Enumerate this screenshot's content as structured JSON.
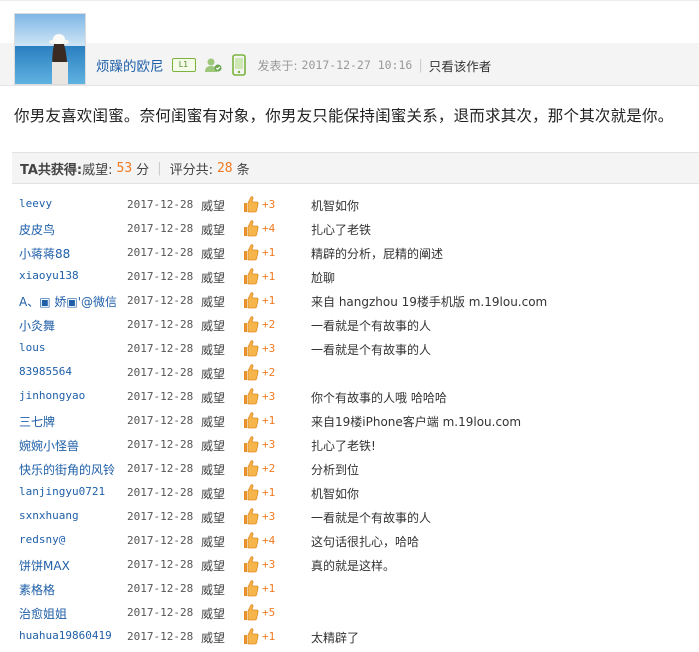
{
  "post": {
    "author": "烦躁的欧尼",
    "level_badge": "L1",
    "posted_label": "发表于:",
    "posted_time": "2017-12-27 10:16",
    "only_author": "只看该作者",
    "content": "你男友喜欢闺蜜。奈何闺蜜有对象，你男友只能保持闺蜜关系，退而求其次，那个其次就是你。"
  },
  "rating_summary": {
    "prefix": "TA共获得:",
    "type_label": "威望:",
    "points": "53",
    "points_unit": "分",
    "count_label": "评分共:",
    "count": "28",
    "count_unit": "条"
  },
  "ratings": [
    {
      "user": "leevy",
      "date": "2017-12-28",
      "type": "威望",
      "score": "+3",
      "reason": "机智如你"
    },
    {
      "user": "皮皮鸟",
      "date": "2017-12-28",
      "type": "威望",
      "score": "+4",
      "reason": "扎心了老铁"
    },
    {
      "user": "小蒋蒋88",
      "date": "2017-12-28",
      "type": "威望",
      "score": "+1",
      "reason": "精辟的分析，屁精的阐述"
    },
    {
      "user": "xiaoyu138",
      "date": "2017-12-28",
      "type": "威望",
      "score": "+1",
      "reason": "尬聊"
    },
    {
      "user": "A、▣ 娇▣'@微信",
      "date": "2017-12-28",
      "type": "威望",
      "score": "+1",
      "reason": "来自 hangzhou 19楼手机版 m.19lou.com"
    },
    {
      "user": "小灸舞",
      "date": "2017-12-28",
      "type": "威望",
      "score": "+2",
      "reason": "一看就是个有故事的人"
    },
    {
      "user": "lous",
      "date": "2017-12-28",
      "type": "威望",
      "score": "+3",
      "reason": "一看就是个有故事的人"
    },
    {
      "user": "83985564",
      "date": "2017-12-28",
      "type": "威望",
      "score": "+2",
      "reason": ""
    },
    {
      "user": "jinhongyao",
      "date": "2017-12-28",
      "type": "威望",
      "score": "+3",
      "reason": "你个有故事的人哦 哈哈哈"
    },
    {
      "user": "三七牌",
      "date": "2017-12-28",
      "type": "威望",
      "score": "+1",
      "reason": "来自19楼iPhone客户端 m.19lou.com"
    },
    {
      "user": "婉婉小怪兽",
      "date": "2017-12-28",
      "type": "威望",
      "score": "+3",
      "reason": "扎心了老铁!"
    },
    {
      "user": "快乐的街角的风铃",
      "date": "2017-12-28",
      "type": "威望",
      "score": "+2",
      "reason": "分析到位"
    },
    {
      "user": "lanjingyu0721",
      "date": "2017-12-28",
      "type": "威望",
      "score": "+1",
      "reason": "机智如你"
    },
    {
      "user": "sxnxhuang",
      "date": "2017-12-28",
      "type": "威望",
      "score": "+3",
      "reason": "一看就是个有故事的人"
    },
    {
      "user": "redsny@",
      "date": "2017-12-28",
      "type": "威望",
      "score": "+4",
      "reason": "这句话很扎心，哈哈"
    },
    {
      "user": "饼饼MAX",
      "date": "2017-12-28",
      "type": "威望",
      "score": "+3",
      "reason": "真的就是这样。"
    },
    {
      "user": "素格格",
      "date": "2017-12-28",
      "type": "威望",
      "score": "+1",
      "reason": ""
    },
    {
      "user": "治愈姐姐",
      "date": "2017-12-28",
      "type": "威望",
      "score": "+5",
      "reason": ""
    },
    {
      "user": "huahua19860419",
      "date": "2017-12-28",
      "type": "威望",
      "score": "+1",
      "reason": "太精辟了"
    }
  ],
  "colors": {
    "link": "#1f5fa8",
    "score": "#f07a23",
    "thumb": "#f0a53a"
  },
  "icons": {
    "thumb": "thumbs-up-icon",
    "user": "user-verified-icon",
    "phone": "mobile-phone-icon"
  }
}
